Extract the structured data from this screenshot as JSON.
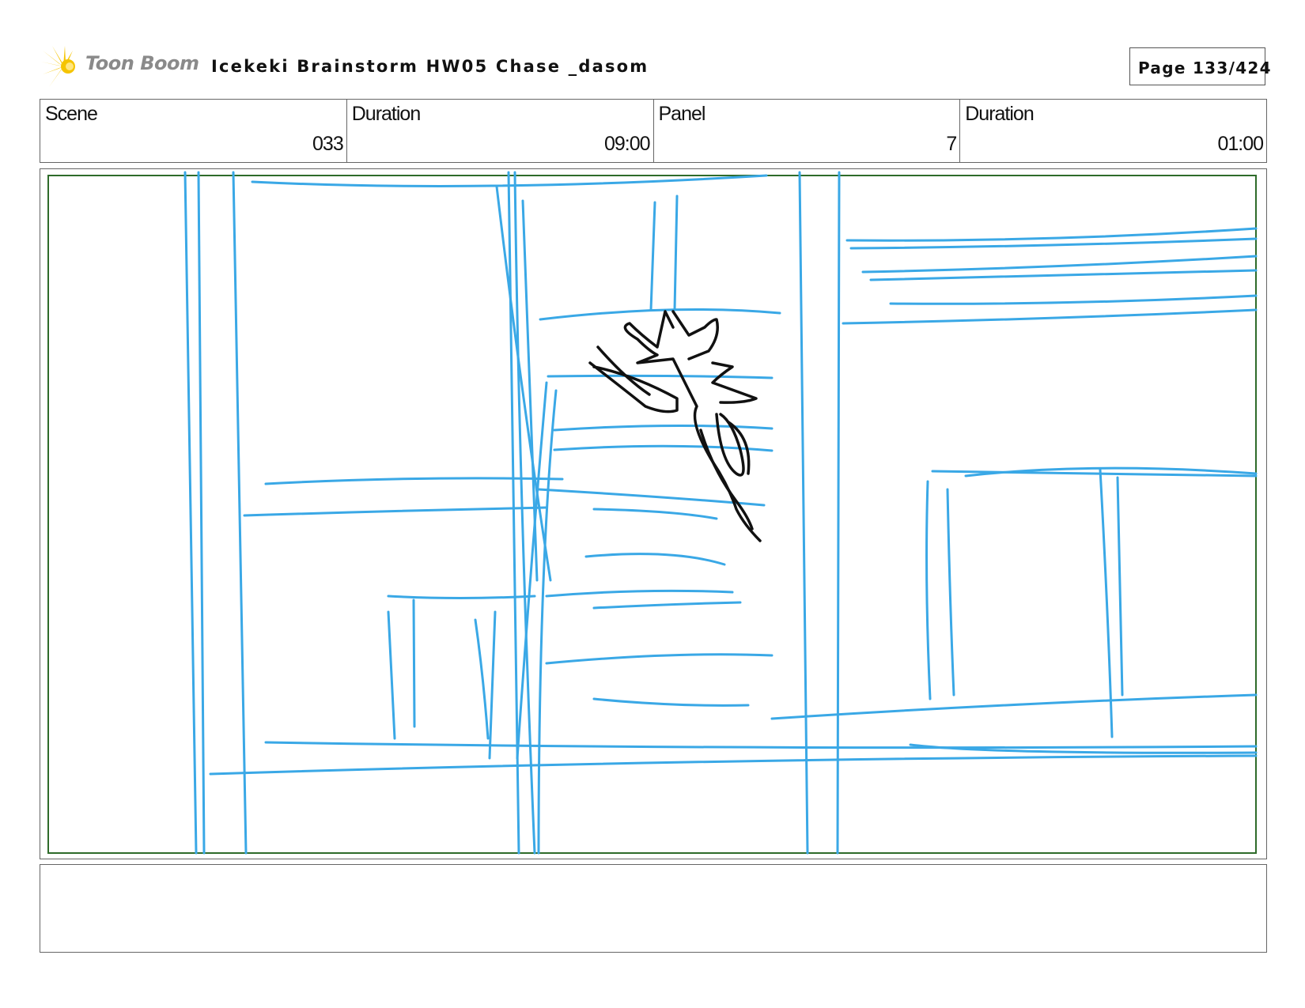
{
  "header": {
    "logo_text": "Toon Boom",
    "title": "Icekeki  Brainstorm HW05 Chase _dasom",
    "page_label": "Page 133/424"
  },
  "info": {
    "scene_label": "Scene",
    "scene_value": "033",
    "scene_duration_label": "Duration",
    "scene_duration_value": "09:00",
    "panel_label": "Panel",
    "panel_value": "7",
    "panel_duration_label": "Duration",
    "panel_duration_value": "01:00"
  },
  "caption": {
    "text": ""
  },
  "colors": {
    "sketch_blue": "#3aa8e6",
    "sketch_black": "#111111",
    "safe_frame_green": "#2e6b2a",
    "logo_yellow": "#f5c400",
    "border_gray": "#666666"
  },
  "icons": {
    "logo": "toon-boom-starburst-icon"
  }
}
